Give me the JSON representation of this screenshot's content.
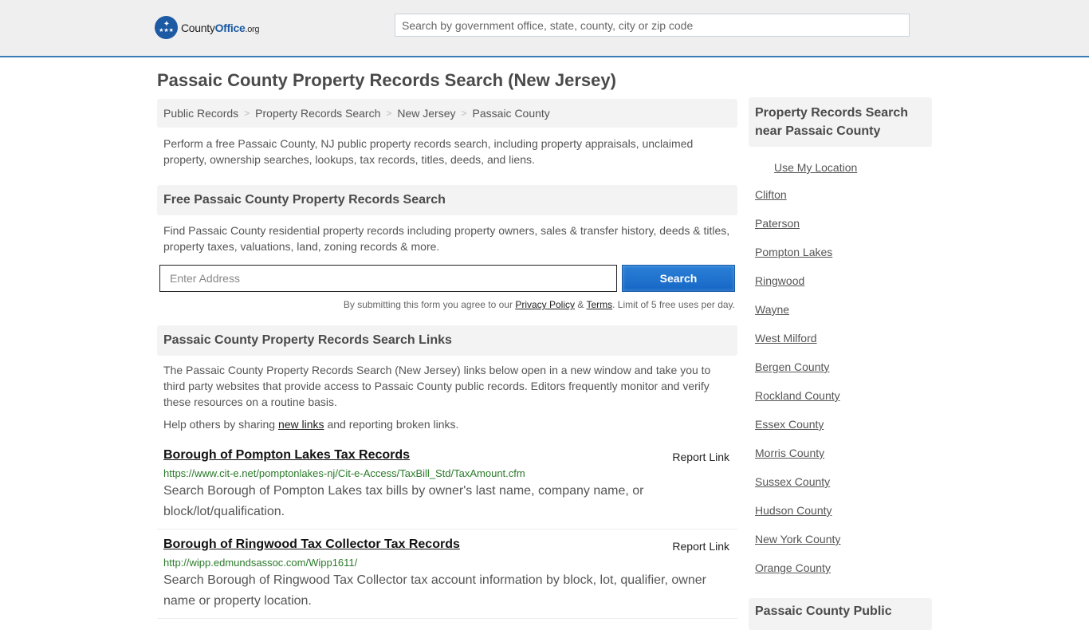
{
  "header": {
    "logo": {
      "name_part1": "County",
      "name_part2": "Office",
      "name_suffix": ".org"
    },
    "search_placeholder": "Search by government office, state, county, city or zip code"
  },
  "page_title": "Passaic County Property Records Search (New Jersey)",
  "breadcrumb": [
    "Public Records",
    "Property Records Search",
    "New Jersey",
    "Passaic County"
  ],
  "breadcrumb_separator": ">",
  "intro": "Perform a free Passaic County, NJ public property records search, including property appraisals, unclaimed property, ownership searches, lookups, tax records, titles, deeds, and liens.",
  "free_search": {
    "heading": "Free Passaic County Property Records Search",
    "description": "Find Passaic County residential property records including property owners, sales & transfer history, deeds & titles, property taxes, valuations, land, zoning records & more.",
    "address_placeholder": "Enter Address",
    "button_label": "Search",
    "disclaimer_prefix": "By submitting this form you agree to our ",
    "privacy_label": "Privacy Policy",
    "amp": " & ",
    "terms_label": "Terms",
    "disclaimer_suffix": ". Limit of 5 free uses per day."
  },
  "links_section": {
    "heading": "Passaic County Property Records Search Links",
    "description": "The Passaic County Property Records Search (New Jersey) links below open in a new window and take you to third party websites that provide access to Passaic County public records. Editors frequently monitor and verify these resources on a routine basis.",
    "help_prefix": "Help others by sharing ",
    "help_link": "new links",
    "help_suffix": " and reporting broken links.",
    "items": [
      {
        "title": "Borough of Pompton Lakes Tax Records",
        "report": "Report Link",
        "url": "https://www.cit-e.net/pomptonlakes-nj/Cit-e-Access/TaxBill_Std/TaxAmount.cfm",
        "description": "Search Borough of Pompton Lakes tax bills by owner's last name, company name, or block/lot/qualification."
      },
      {
        "title": "Borough of Ringwood Tax Collector Tax Records",
        "report": "Report Link",
        "url": "http://wipp.edmundsassoc.com/Wipp1611/",
        "description": "Search Borough of Ringwood Tax Collector tax account information by block, lot, qualifier, owner name or property location."
      }
    ]
  },
  "sidebar": {
    "heading": "Property Records Search near Passaic County",
    "use_location": "Use My Location",
    "nearby": [
      "Clifton",
      "Paterson",
      "Pompton Lakes",
      "Ringwood",
      "Wayne",
      "West Milford",
      "Bergen County",
      "Rockland County",
      "Essex County",
      "Morris County",
      "Sussex County",
      "Hudson County",
      "New York County",
      "Orange County"
    ],
    "next_heading": "Passaic County Public"
  }
}
